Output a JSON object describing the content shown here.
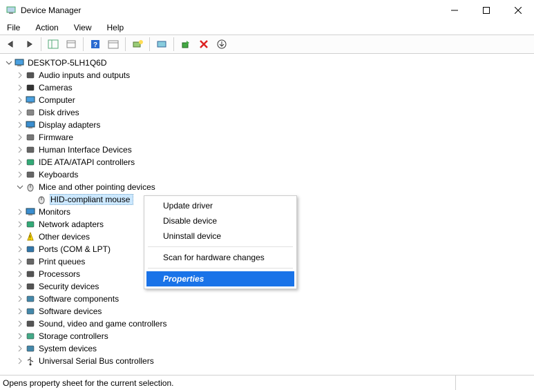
{
  "window": {
    "title": "Device Manager"
  },
  "menubar": [
    "File",
    "Action",
    "View",
    "Help"
  ],
  "tree": {
    "root": "DESKTOP-5LH1Q6D",
    "children": [
      {
        "label": "Audio inputs and outputs",
        "icon": "speaker",
        "expanded": false
      },
      {
        "label": "Cameras",
        "icon": "camera",
        "expanded": false
      },
      {
        "label": "Computer",
        "icon": "computer",
        "expanded": false
      },
      {
        "label": "Disk drives",
        "icon": "disk",
        "expanded": false
      },
      {
        "label": "Display adapters",
        "icon": "display",
        "expanded": false
      },
      {
        "label": "Firmware",
        "icon": "firmware",
        "expanded": false
      },
      {
        "label": "Human Interface Devices",
        "icon": "hid",
        "expanded": false
      },
      {
        "label": "IDE ATA/ATAPI controllers",
        "icon": "ide",
        "expanded": false
      },
      {
        "label": "Keyboards",
        "icon": "keyboard",
        "expanded": false
      },
      {
        "label": "Mice and other pointing devices",
        "icon": "mouse",
        "expanded": true,
        "children": [
          {
            "label": "HID-compliant mouse",
            "icon": "mouse",
            "selected": true
          }
        ]
      },
      {
        "label": "Monitors",
        "icon": "monitor",
        "expanded": false
      },
      {
        "label": "Network adapters",
        "icon": "network",
        "expanded": false
      },
      {
        "label": "Other devices",
        "icon": "other",
        "expanded": false
      },
      {
        "label": "Ports (COM & LPT)",
        "icon": "port",
        "expanded": false
      },
      {
        "label": "Print queues",
        "icon": "printer",
        "expanded": false
      },
      {
        "label": "Processors",
        "icon": "cpu",
        "expanded": false
      },
      {
        "label": "Security devices",
        "icon": "security",
        "expanded": false
      },
      {
        "label": "Software components",
        "icon": "swcomp",
        "expanded": false
      },
      {
        "label": "Software devices",
        "icon": "swdev",
        "expanded": false
      },
      {
        "label": "Sound, video and game controllers",
        "icon": "sound",
        "expanded": false
      },
      {
        "label": "Storage controllers",
        "icon": "storage",
        "expanded": false
      },
      {
        "label": "System devices",
        "icon": "system",
        "expanded": false
      },
      {
        "label": "Universal Serial Bus controllers",
        "icon": "usb",
        "expanded": false
      }
    ]
  },
  "contextMenu": {
    "items": [
      {
        "label": "Update driver"
      },
      {
        "label": "Disable device"
      },
      {
        "label": "Uninstall device"
      },
      {
        "sep": true
      },
      {
        "label": "Scan for hardware changes"
      },
      {
        "sep": true
      },
      {
        "label": "Properties",
        "highlight": true
      }
    ]
  },
  "statusbar": {
    "text": "Opens property sheet for the current selection."
  }
}
